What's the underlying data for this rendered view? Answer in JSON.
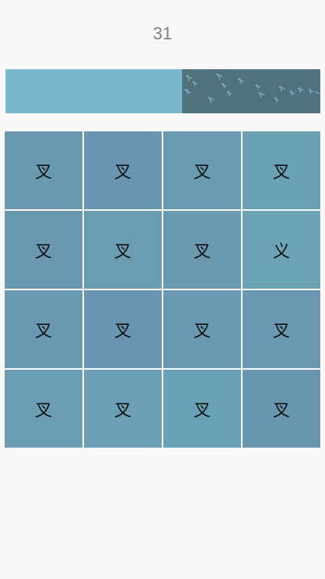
{
  "score": "31",
  "timer": {
    "remaining_fraction": 0.56
  },
  "grid": {
    "columns": 4,
    "cells": [
      {
        "char": "叉",
        "color": "#6b9ab0"
      },
      {
        "char": "叉",
        "color": "#6a96b1"
      },
      {
        "char": "叉",
        "color": "#6a9bb1"
      },
      {
        "char": "叉",
        "color": "#6aa1b3"
      },
      {
        "char": "叉",
        "color": "#6a98b1"
      },
      {
        "char": "叉",
        "color": "#6a9db2"
      },
      {
        "char": "叉",
        "color": "#6a99b0"
      },
      {
        "char": "义",
        "color": "#6ba2b4"
      },
      {
        "char": "叉",
        "color": "#6a9ab2"
      },
      {
        "char": "叉",
        "color": "#6a95b1"
      },
      {
        "char": "叉",
        "color": "#6a9ab1"
      },
      {
        "char": "叉",
        "color": "#6a98b0"
      },
      {
        "char": "叉",
        "color": "#6a9cb2"
      },
      {
        "char": "叉",
        "color": "#6b9fb3"
      },
      {
        "char": "叉",
        "color": "#6aa0b4"
      },
      {
        "char": "叉",
        "color": "#6a97b0"
      }
    ]
  }
}
